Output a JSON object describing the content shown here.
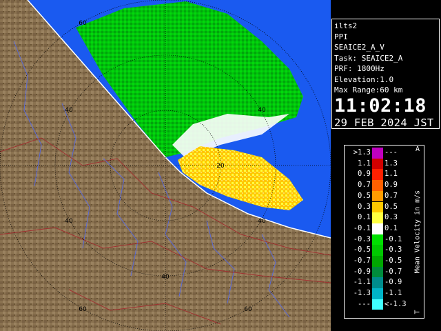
{
  "info": {
    "radar_name": "ilts2",
    "mode": "PPI",
    "product": "SEAICE2_A_V",
    "task": "Task: SEAICE2_A",
    "prf": "PRF: 1800Hz",
    "elevation": "Elevation:1.0",
    "max_range": "Max Range:60 km",
    "time": "11:02:18",
    "date": "29 FEB 2024 JST"
  },
  "range_rings": [
    "20",
    "40",
    "60",
    "40",
    "40",
    "40",
    "60",
    "60"
  ],
  "legend": {
    "unit": "Mean Velocity in m/s",
    "top_marker": "A",
    "bottom_marker": "T",
    "rows": [
      {
        "left": ">1.3",
        "right": "---",
        "color": "#c000c0"
      },
      {
        "left": "1.1",
        "right": "1.3",
        "color": "#d00000"
      },
      {
        "left": "0.9",
        "right": "1.1",
        "color": "#ff2000"
      },
      {
        "left": "0.7",
        "right": "0.9",
        "color": "#ff6000"
      },
      {
        "left": "0.5",
        "right": "0.7",
        "color": "#ff9c00"
      },
      {
        "left": "0.3",
        "right": "0.5",
        "color": "#ffc800"
      },
      {
        "left": "0.1",
        "right": "0.3",
        "color": "#ffff40"
      },
      {
        "left": "-0.1",
        "right": "0.1",
        "color": "#ffffff"
      },
      {
        "left": "-0.3",
        "right": "-0.1",
        "color": "#00e000"
      },
      {
        "left": "-0.5",
        "right": "-0.3",
        "color": "#00c800"
      },
      {
        "left": "-0.7",
        "right": "-0.5",
        "color": "#00a800"
      },
      {
        "left": "-0.9",
        "right": "-0.7",
        "color": "#008c3c"
      },
      {
        "left": "-1.1",
        "right": "-0.9",
        "color": "#008c8c"
      },
      {
        "left": "-1.3",
        "right": "-1.1",
        "color": "#00b4c8"
      },
      {
        "left": "---",
        "right": "<-1.3",
        "color": "#40ffff"
      }
    ]
  },
  "colors": {
    "sea": "#1a5af0",
    "land": "#8a7250",
    "land_dark": "#6b5535",
    "river": "#5a6ad8",
    "border": "#a03030",
    "ring": "#000000"
  }
}
